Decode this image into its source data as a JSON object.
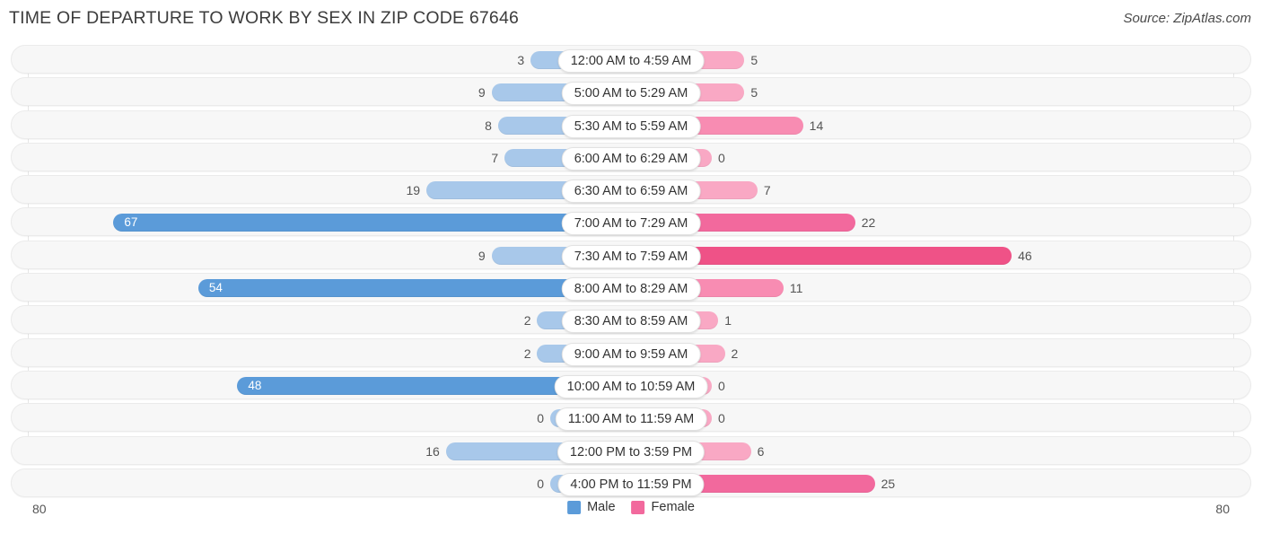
{
  "header": {
    "title": "TIME OF DEPARTURE TO WORK BY SEX IN ZIP CODE 67646",
    "source": "Source: ZipAtlas.com"
  },
  "axis": {
    "left_label": "80",
    "right_label": "80",
    "max": 80
  },
  "legend": {
    "items": [
      {
        "label": "Male",
        "color": "#5b9bd9"
      },
      {
        "label": "Female",
        "color": "#f2699d"
      }
    ]
  },
  "colors": {
    "male_light": "#a8c8ea",
    "male_dark": "#5b9bd9",
    "female_light": "#f9a8c4",
    "female_mid": "#f88cb2",
    "female_dark": "#f2699d",
    "female_darker": "#ef5287",
    "track": "#f7f7f7",
    "track_border": "#ebebeb"
  },
  "chart_data": {
    "type": "bar",
    "title": "TIME OF DEPARTURE TO WORK BY SEX IN ZIP CODE 67646",
    "subtitle": "",
    "xlabel": "",
    "ylabel": "",
    "orientation": "horizontal-diverging",
    "xlim": [
      80,
      80
    ],
    "grid": true,
    "legend_position": "bottom-center",
    "categories": [
      "12:00 AM to 4:59 AM",
      "5:00 AM to 5:29 AM",
      "5:30 AM to 5:59 AM",
      "6:00 AM to 6:29 AM",
      "6:30 AM to 6:59 AM",
      "7:00 AM to 7:29 AM",
      "7:30 AM to 7:59 AM",
      "8:00 AM to 8:29 AM",
      "8:30 AM to 8:59 AM",
      "9:00 AM to 9:59 AM",
      "10:00 AM to 10:59 AM",
      "11:00 AM to 11:59 AM",
      "12:00 PM to 3:59 PM",
      "4:00 PM to 11:59 PM"
    ],
    "series": [
      {
        "name": "Male",
        "values": [
          3,
          9,
          8,
          7,
          19,
          67,
          9,
          54,
          2,
          2,
          48,
          0,
          16,
          0
        ]
      },
      {
        "name": "Female",
        "values": [
          5,
          5,
          14,
          0,
          7,
          22,
          46,
          11,
          1,
          2,
          0,
          0,
          6,
          25
        ]
      }
    ]
  },
  "rows": [
    {
      "label": "12:00 AM to 4:59 AM",
      "male": "3",
      "female": "5"
    },
    {
      "label": "5:00 AM to 5:29 AM",
      "male": "9",
      "female": "5"
    },
    {
      "label": "5:30 AM to 5:59 AM",
      "male": "8",
      "female": "14"
    },
    {
      "label": "6:00 AM to 6:29 AM",
      "male": "7",
      "female": "0"
    },
    {
      "label": "6:30 AM to 6:59 AM",
      "male": "19",
      "female": "7"
    },
    {
      "label": "7:00 AM to 7:29 AM",
      "male": "67",
      "female": "22"
    },
    {
      "label": "7:30 AM to 7:59 AM",
      "male": "9",
      "female": "46"
    },
    {
      "label": "8:00 AM to 8:29 AM",
      "male": "54",
      "female": "11"
    },
    {
      "label": "8:30 AM to 8:59 AM",
      "male": "2",
      "female": "1"
    },
    {
      "label": "9:00 AM to 9:59 AM",
      "male": "2",
      "female": "2"
    },
    {
      "label": "10:00 AM to 10:59 AM",
      "male": "48",
      "female": "0"
    },
    {
      "label": "11:00 AM to 11:59 AM",
      "male": "0",
      "female": "0"
    },
    {
      "label": "12:00 PM to 3:59 PM",
      "male": "16",
      "female": "6"
    },
    {
      "label": "4:00 PM to 11:59 PM",
      "male": "0",
      "female": "25"
    }
  ]
}
